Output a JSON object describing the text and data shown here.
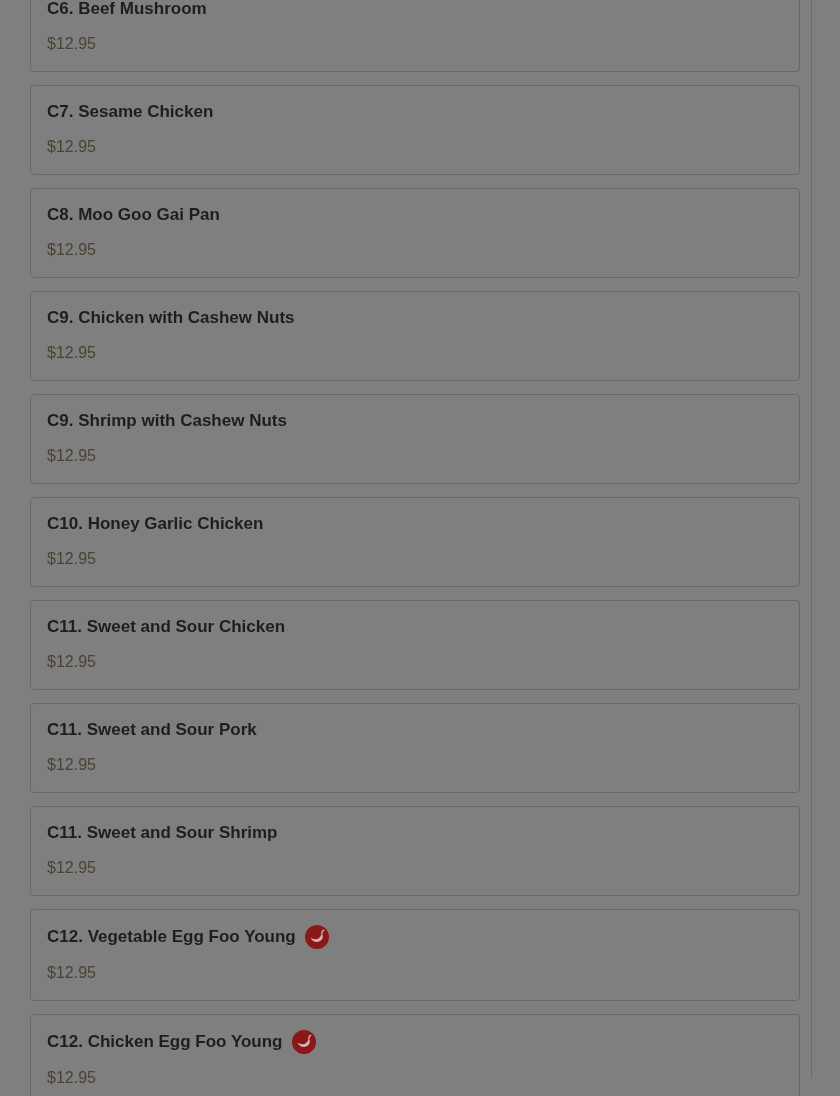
{
  "menu_items": [
    {
      "name": "C6. Beef Mushroom",
      "price": "$12.95",
      "spicy": false
    },
    {
      "name": "C7. Sesame Chicken",
      "price": "$12.95",
      "spicy": false
    },
    {
      "name": "C8. Moo Goo Gai Pan",
      "price": "$12.95",
      "spicy": false
    },
    {
      "name": "C9. Chicken with Cashew Nuts",
      "price": "$12.95",
      "spicy": false
    },
    {
      "name": "C9. Shrimp with Cashew Nuts",
      "price": "$12.95",
      "spicy": false
    },
    {
      "name": "C10. Honey Garlic Chicken",
      "price": "$12.95",
      "spicy": false
    },
    {
      "name": "C11. Sweet and Sour Chicken",
      "price": "$12.95",
      "spicy": false
    },
    {
      "name": "C11. Sweet and Sour Pork",
      "price": "$12.95",
      "spicy": false
    },
    {
      "name": "C11. Sweet and Sour Shrimp",
      "price": "$12.95",
      "spicy": false
    },
    {
      "name": "C12. Vegetable Egg Foo Young",
      "price": "$12.95",
      "spicy": true
    },
    {
      "name": "C12. Chicken Egg Foo Young",
      "price": "$12.95",
      "spicy": true
    }
  ]
}
